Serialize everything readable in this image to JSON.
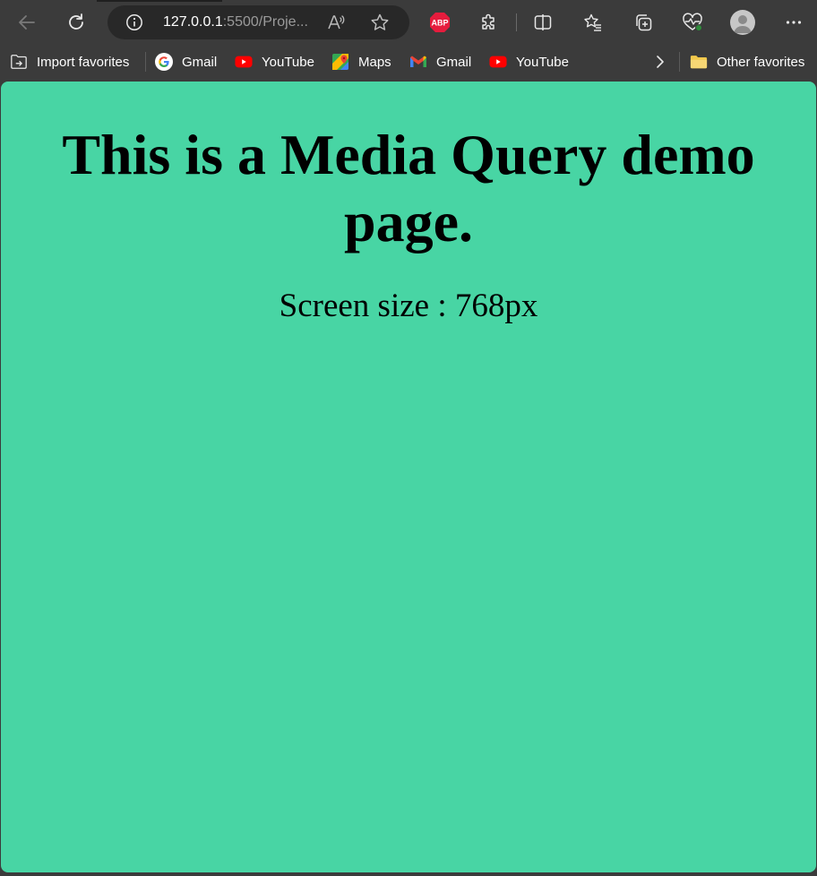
{
  "browser": {
    "address": {
      "host": "127.0.0.1",
      "rest": ":5500/Proje..."
    },
    "extensions": {
      "abp_label": "ABP"
    },
    "bookmarks": [
      {
        "label": "Import favorites",
        "icon": "import-favorites-icon"
      },
      {
        "label": "Gmail",
        "icon": "google-icon"
      },
      {
        "label": "YouTube",
        "icon": "youtube-icon"
      },
      {
        "label": "Maps",
        "icon": "maps-icon"
      },
      {
        "label": "Gmail",
        "icon": "gmail-icon"
      },
      {
        "label": "YouTube",
        "icon": "youtube-icon"
      }
    ],
    "other_favorites": "Other favorites"
  },
  "page": {
    "heading": "This is a Media Query demo page.",
    "screen_size": "Screen size : 768px",
    "background": "#48d5a4"
  }
}
